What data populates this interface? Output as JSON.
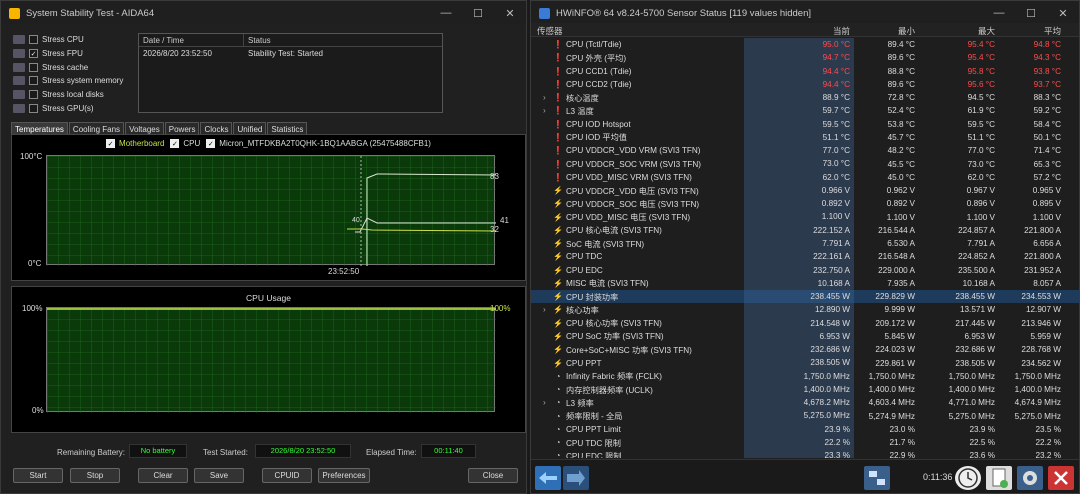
{
  "aida": {
    "title": "System Stability Test - AIDA64",
    "stress": [
      {
        "label": "Stress CPU",
        "checked": false
      },
      {
        "label": "Stress FPU",
        "checked": true
      },
      {
        "label": "Stress cache",
        "checked": false
      },
      {
        "label": "Stress system memory",
        "checked": false
      },
      {
        "label": "Stress local disks",
        "checked": false
      },
      {
        "label": "Stress GPU(s)",
        "checked": false
      }
    ],
    "log": {
      "col_date": "Date / Time",
      "col_status": "Status",
      "date": "2026/8/20 23:52:50",
      "status": "Stability Test: Started"
    },
    "tabs": [
      "Temperatures",
      "Cooling Fans",
      "Voltages",
      "Powers",
      "Clocks",
      "Unified",
      "Statistics"
    ],
    "temp_graph": {
      "legend": [
        "Motherboard",
        "CPU",
        "Micron_MTFDKBA2T0QHK-1BQ1AABGA (25475488CFB1)"
      ],
      "y_top": "100°C",
      "y_bottom": "0°C",
      "time": "23:52:50",
      "values": [
        "83",
        "41",
        "32"
      ],
      "mini_label": "40"
    },
    "cpu_graph": {
      "title": "CPU Usage",
      "y_top": "100%",
      "y_bottom": "0%",
      "value": "100%"
    },
    "footer": {
      "battery_label": "Remaining Battery:",
      "battery": "No battery",
      "started_label": "Test Started:",
      "started": "2026/8/20 23:52:50",
      "elapsed_label": "Elapsed Time:",
      "elapsed": "00:11:40"
    },
    "buttons": {
      "start": "Start",
      "stop": "Stop",
      "clear": "Clear",
      "save": "Save",
      "cpuid": "CPUID",
      "prefs": "Preferences",
      "close": "Close"
    }
  },
  "hw": {
    "title": "HWiNFO® 64 v8.24-5700 Sensor Status [119 values hidden]",
    "head": {
      "sensor": "传感器",
      "current": "当前",
      "min": "最小",
      "max": "最大",
      "avg": "平均"
    },
    "rows": [
      {
        "icon": "t",
        "name": "CPU (Tctl/Tdie)",
        "cur": "95.0 °C",
        "min": "89.4 °C",
        "max": "95.4 °C",
        "avg": "94.8 °C",
        "red": true
      },
      {
        "icon": "t",
        "name": "CPU 外壳 (平均)",
        "cur": "94.7 °C",
        "min": "89.6 °C",
        "max": "95.4 °C",
        "avg": "94.3 °C",
        "red": true
      },
      {
        "icon": "t",
        "name": "CPU CCD1 (Tdie)",
        "cur": "94.4 °C",
        "min": "88.8 °C",
        "max": "95.8 °C",
        "avg": "93.8 °C",
        "red": true
      },
      {
        "icon": "t",
        "name": "CPU CCD2 (Tdie)",
        "cur": "94.4 °C",
        "min": "89.6 °C",
        "max": "95.6 °C",
        "avg": "93.7 °C",
        "red": true
      },
      {
        "icon": "t",
        "exp": true,
        "name": "核心温度",
        "cur": "88.9 °C",
        "min": "72.8 °C",
        "max": "94.5 °C",
        "avg": "88.3 °C"
      },
      {
        "icon": "t",
        "exp": true,
        "name": "L3 温度",
        "cur": "59.7 °C",
        "min": "52.4 °C",
        "max": "61.9 °C",
        "avg": "59.2 °C"
      },
      {
        "icon": "t",
        "name": "CPU IOD Hotspot",
        "cur": "59.5 °C",
        "min": "53.8 °C",
        "max": "59.5 °C",
        "avg": "58.4 °C"
      },
      {
        "icon": "t",
        "name": "CPU IOD 平均值",
        "cur": "51.1 °C",
        "min": "45.7 °C",
        "max": "51.1 °C",
        "avg": "50.1 °C"
      },
      {
        "icon": "t",
        "name": "CPU VDDCR_VDD VRM (SVI3 TFN)",
        "cur": "77.0 °C",
        "min": "48.2 °C",
        "max": "77.0 °C",
        "avg": "71.4 °C"
      },
      {
        "icon": "t",
        "name": "CPU VDDCR_SOC VRM (SVI3 TFN)",
        "cur": "73.0 °C",
        "min": "45.5 °C",
        "max": "73.0 °C",
        "avg": "65.3 °C"
      },
      {
        "icon": "t",
        "name": "CPU VDD_MISC VRM (SVI3 TFN)",
        "cur": "62.0 °C",
        "min": "45.0 °C",
        "max": "62.0 °C",
        "avg": "57.2 °C"
      },
      {
        "icon": "p",
        "name": "CPU VDDCR_VDD 电压 (SVI3 TFN)",
        "cur": "0.966 V",
        "min": "0.962 V",
        "max": "0.967 V",
        "avg": "0.965 V"
      },
      {
        "icon": "p",
        "name": "CPU VDDCR_SOC 电压 (SVI3 TFN)",
        "cur": "0.892 V",
        "min": "0.892 V",
        "max": "0.896 V",
        "avg": "0.895 V"
      },
      {
        "icon": "p",
        "name": "CPU VDD_MISC 电压 (SVI3 TFN)",
        "cur": "1.100 V",
        "min": "1.100 V",
        "max": "1.100 V",
        "avg": "1.100 V"
      },
      {
        "icon": "p",
        "name": "CPU 核心电流 (SVI3 TFN)",
        "cur": "222.152 A",
        "min": "216.544 A",
        "max": "224.857 A",
        "avg": "221.800 A"
      },
      {
        "icon": "p",
        "name": "SoC 电流 (SVI3 TFN)",
        "cur": "7.791 A",
        "min": "6.530 A",
        "max": "7.791 A",
        "avg": "6.656 A"
      },
      {
        "icon": "p",
        "name": "CPU TDC",
        "cur": "222.161 A",
        "min": "216.548 A",
        "max": "224.852 A",
        "avg": "221.800 A"
      },
      {
        "icon": "p",
        "name": "CPU EDC",
        "cur": "232.750 A",
        "min": "229.000 A",
        "max": "235.500 A",
        "avg": "231.952 A"
      },
      {
        "icon": "p",
        "name": "MISC 电流 (SVI3 TFN)",
        "cur": "10.168 A",
        "min": "7.935 A",
        "max": "10.168 A",
        "avg": "8.057 A"
      },
      {
        "icon": "p",
        "name": "CPU 封装功率",
        "cur": "238.455 W",
        "min": "229.829 W",
        "max": "238.455 W",
        "avg": "234.553 W",
        "sel": true
      },
      {
        "icon": "p",
        "exp": true,
        "name": "核心功率",
        "cur": "12.890 W",
        "min": "9.999 W",
        "max": "13.571 W",
        "avg": "12.907 W"
      },
      {
        "icon": "p",
        "name": "CPU 核心功率 (SVI3 TFN)",
        "cur": "214.548 W",
        "min": "209.172 W",
        "max": "217.445 W",
        "avg": "213.946 W"
      },
      {
        "icon": "p",
        "name": "CPU SoC 功率 (SVI3 TFN)",
        "cur": "6.953 W",
        "min": "5.845 W",
        "max": "6.953 W",
        "avg": "5.959 W"
      },
      {
        "icon": "p",
        "name": "Core+SoC+MISC 功率 (SVI3 TFN)",
        "cur": "232.686 W",
        "min": "224.023 W",
        "max": "232.686 W",
        "avg": "228.768 W"
      },
      {
        "icon": "p",
        "name": "CPU PPT",
        "cur": "238.505 W",
        "min": "229.861 W",
        "max": "238.505 W",
        "avg": "234.562 W"
      },
      {
        "icon": "c",
        "name": "Infinity Fabric 频率 (FCLK)",
        "cur": "1,750.0 MHz",
        "min": "1,750.0 MHz",
        "max": "1,750.0 MHz",
        "avg": "1,750.0 MHz"
      },
      {
        "icon": "c",
        "name": "内存控制器频率 (UCLK)",
        "cur": "1,400.0 MHz",
        "min": "1,400.0 MHz",
        "max": "1,400.0 MHz",
        "avg": "1,400.0 MHz"
      },
      {
        "icon": "c",
        "exp": true,
        "name": "L3 频率",
        "cur": "4,678.2 MHz",
        "min": "4,603.4 MHz",
        "max": "4,771.0 MHz",
        "avg": "4,674.9 MHz"
      },
      {
        "icon": "c",
        "name": "频率限制 - 全局",
        "cur": "5,275.0 MHz",
        "min": "5,274.9 MHz",
        "max": "5,275.0 MHz",
        "avg": "5,275.0 MHz"
      },
      {
        "icon": "c",
        "name": "CPU PPT Limit",
        "cur": "23.9 %",
        "min": "23.0 %",
        "max": "23.9 %",
        "avg": "23.5 %"
      },
      {
        "icon": "c",
        "name": "CPU TDC 限制",
        "cur": "22.2 %",
        "min": "21.7 %",
        "max": "22.5 %",
        "avg": "22.2 %"
      },
      {
        "icon": "c",
        "name": "CPU EDC 限制",
        "cur": "23.3 %",
        "min": "22.9 %",
        "max": "23.6 %",
        "avg": "23.2 %"
      }
    ],
    "footer_time": "0:11:36"
  }
}
